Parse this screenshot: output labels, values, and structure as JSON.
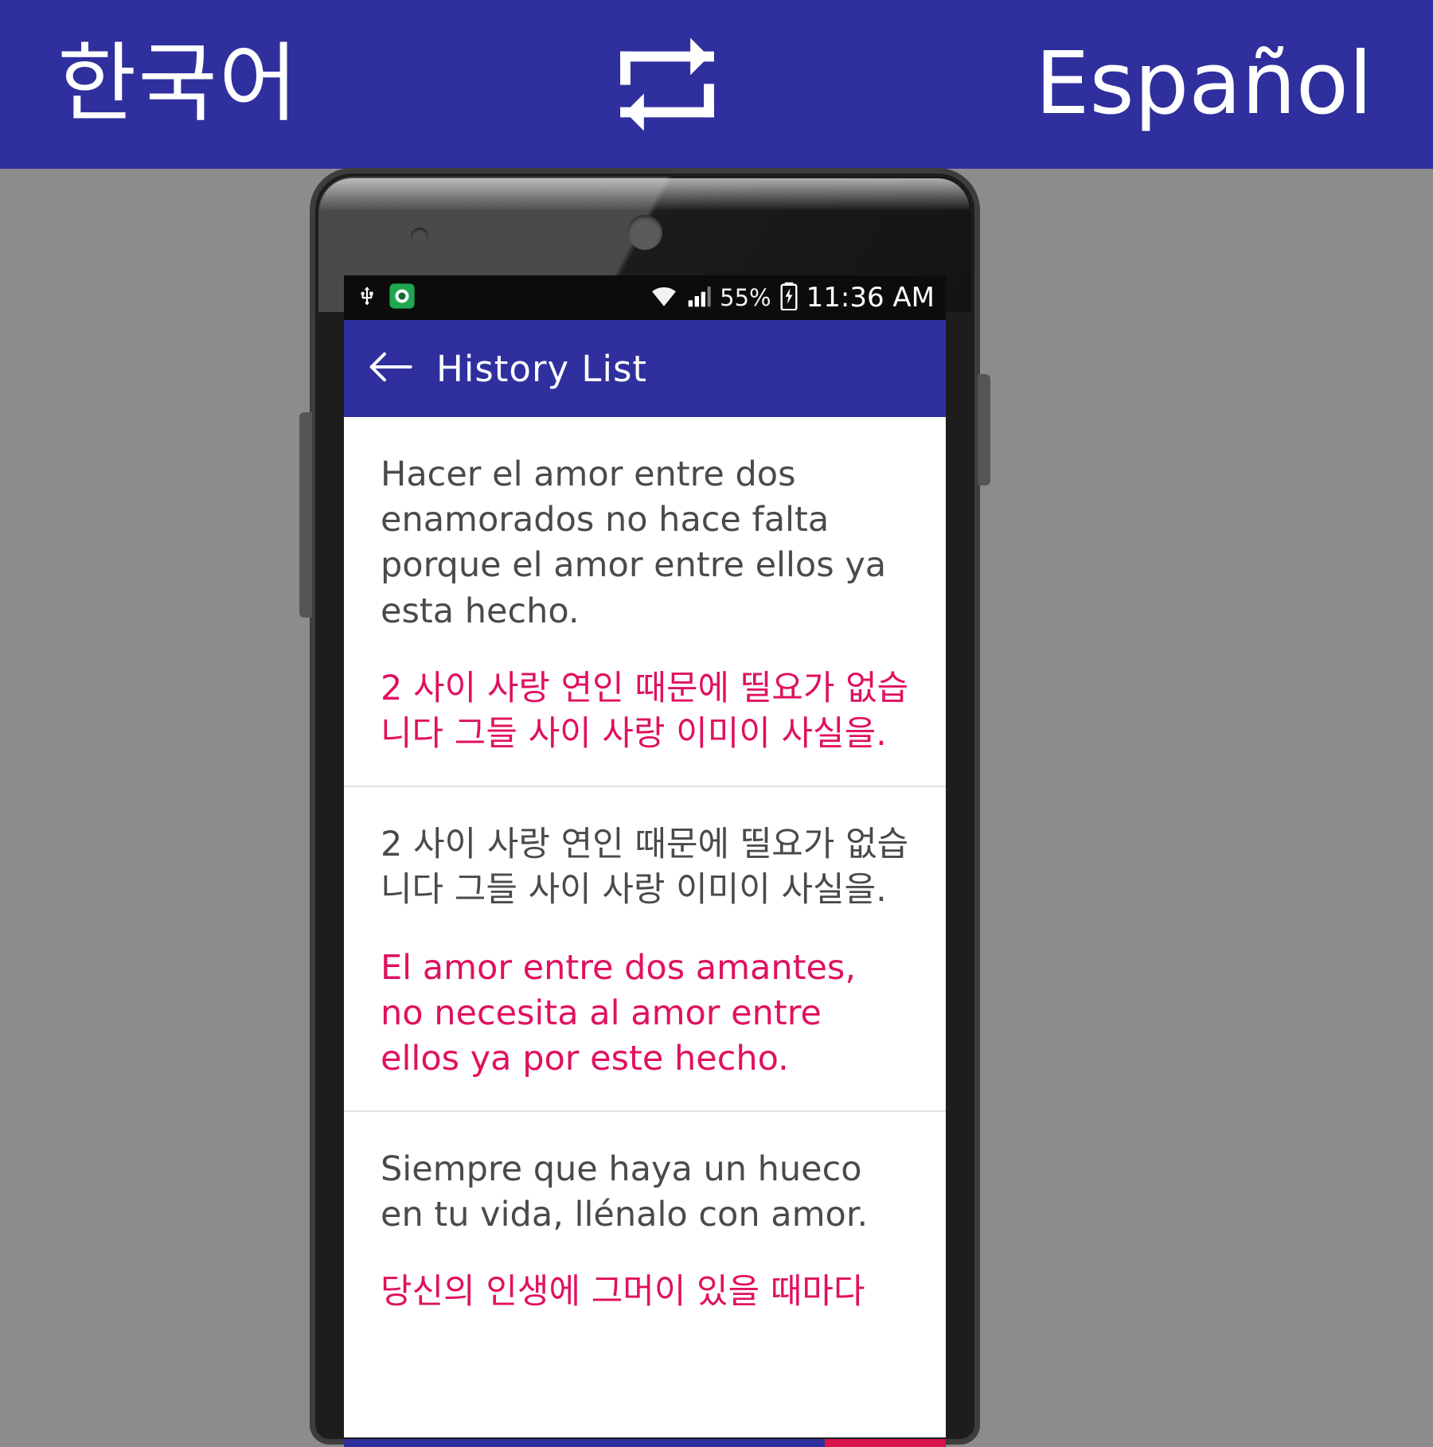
{
  "banner": {
    "source_language": "한국어",
    "target_language": "Español",
    "swap_icon": "repeat-swap-icon",
    "background_color": "#2f2f9e",
    "text_color": "#ffffff"
  },
  "status_bar": {
    "usb_icon": "usb-icon",
    "app_icon": "app-notification-icon",
    "wifi_icon": "wifi-icon",
    "signal_icon": "cellular-signal-icon",
    "battery_percent": "55%",
    "battery_icon": "battery-charging-icon",
    "time": "11:36 AM"
  },
  "app_bar": {
    "back_icon": "back-arrow-icon",
    "title": "History List",
    "background_color": "#2f2f9e"
  },
  "history": {
    "accent_color": "#e0115f",
    "source_color": "#4a4a4a",
    "items": [
      {
        "source": "Hacer el amor entre dos enamorados no hace falta porque el amor entre ellos ya esta hecho.",
        "translation": "2 사이 사랑 연인 때문에 띨요가 없습니다 그들 사이 사랑 이미이 사실을."
      },
      {
        "source": "2 사이 사랑 연인 때문에 띨요가 없습니다 그들 사이 사랑 이미이 사실을.",
        "translation": "El amor entre dos amantes, no necesita al amor entre ellos ya por este hecho."
      },
      {
        "source": "Siempre que haya un hueco en tu vida, llénalo con amor.",
        "translation": "당신의 인생에 그머이 있을 때마다"
      }
    ]
  }
}
